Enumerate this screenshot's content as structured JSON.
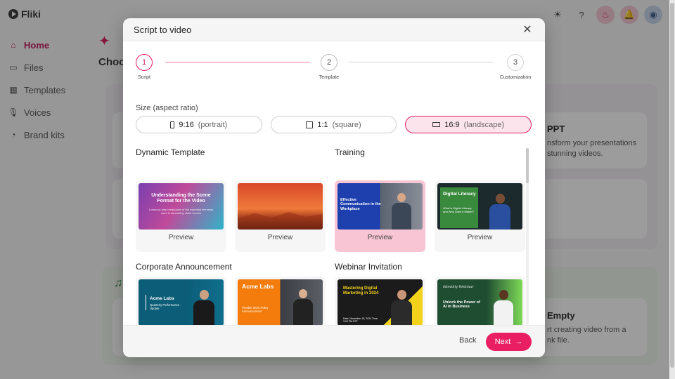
{
  "app": {
    "logo": "Fliki",
    "nav": [
      {
        "label": "Home",
        "icon": "home-icon",
        "glyph": "⌂"
      },
      {
        "label": "Files",
        "icon": "folder-icon",
        "glyph": "▭"
      },
      {
        "label": "Templates",
        "icon": "templates-icon",
        "glyph": "▦"
      },
      {
        "label": "Voices",
        "icon": "microphone-icon",
        "glyph": "🎙"
      },
      {
        "label": "Brand kits",
        "icon": "palette-icon",
        "glyph": "◔"
      }
    ],
    "bg_title_partial": "Choo",
    "bg_cards": {
      "ppt_title": "PPT",
      "ppt_desc_1": "nsform your presentations",
      "ppt_desc_2": "stunning videos.",
      "empty_title": "Empty",
      "empty_desc_1": "rt creating video from a",
      "empty_desc_2": "nk file."
    }
  },
  "modal": {
    "title": "Script to video",
    "steps": [
      {
        "number": "1",
        "label": "Script"
      },
      {
        "number": "2",
        "label": "Template"
      },
      {
        "number": "3",
        "label": "Customization"
      }
    ],
    "size_label": "Size (aspect ratio)",
    "sizes": [
      {
        "ratio": "9:16",
        "desc": "(portrait)"
      },
      {
        "ratio": "1:1",
        "desc": "(square)"
      },
      {
        "ratio": "16:9",
        "desc": "(landscape)"
      }
    ],
    "selected_size": 2,
    "categories": {
      "dynamic": "Dynamic Template",
      "training": "Training",
      "corporate": "Corporate Announcement",
      "webinar": "Webinar Invitation"
    },
    "preview_label": "Preview",
    "thumbs": {
      "scene_title": "Understanding the Scene Format for the Video",
      "scene_sub": "A step-by-step breakdown of the essential elements used in structuring video scenes",
      "training_title": "Effective Communication in the Workplace",
      "literacy_title": "Digital Literacy",
      "literacy_sub": "What is Digital Literacy and Why Does it Matter?",
      "acme1_title": "Acme Labs",
      "acme1_sub": "Quarterly Performance Update",
      "acme2_title": "Acme Labs",
      "acme2_sub": "Flexible Work Policy Announcement",
      "webinar_title": "Mastering Digital Marketing in 2024",
      "webinar_date": "Date: November 15, 2024 Time: 3:00 PM EST",
      "monthly_script": "Monthly Webinar",
      "monthly_title": "Unlock the Power of AI in Business"
    },
    "back_label": "Back",
    "next_label": "Next",
    "colors": {
      "accent": "#e91e63",
      "selected_bg": "#fce4ec"
    }
  }
}
